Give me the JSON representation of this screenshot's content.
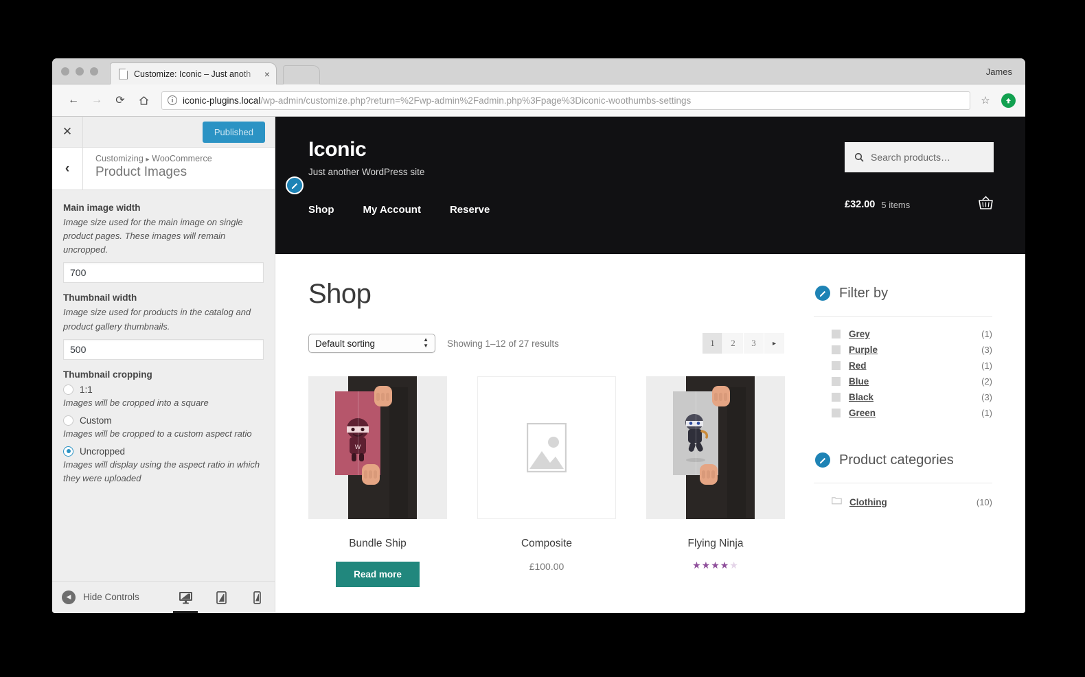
{
  "browser": {
    "tab_title": "Customize: Iconic – Just anoth",
    "tab_close": "×",
    "user": "James",
    "url_host": "iconic-plugins.local",
    "url_rest": "/wp-admin/customize.php?return=%2Fwp-admin%2Fadmin.php%3Fpage%3Diconic-woothumbs-settings",
    "info_glyph": "i",
    "back_glyph": "←",
    "forward_glyph": "→",
    "reload_glyph": "⟳",
    "home_glyph": "⌂",
    "bookmark_glyph": "☆"
  },
  "customizer": {
    "close_label": "✕",
    "publish_label": "Published",
    "back_glyph": "‹",
    "breadcrumb_root": "Customizing",
    "breadcrumb_sep": "▸",
    "breadcrumb_section": "WooCommerce",
    "panel_title": "Product Images",
    "controls": [
      {
        "label": "Main image width",
        "description": "Image size used for the main image on single product pages. These images will remain uncropped.",
        "value": "700"
      },
      {
        "label": "Thumbnail width",
        "description": "Image size used for products in the catalog and product gallery thumbnails.",
        "value": "500"
      }
    ],
    "cropping": {
      "label": "Thumbnail cropping",
      "options": [
        {
          "label": "1:1",
          "description": "Images will be cropped into a square",
          "selected": false
        },
        {
          "label": "Custom",
          "description": "Images will be cropped to a custom aspect ratio",
          "selected": false
        },
        {
          "label": "Uncropped",
          "description": "Images will display using the aspect ratio in which they were uploaded",
          "selected": true
        }
      ]
    },
    "footer": {
      "hide_controls_label": "Hide Controls",
      "devices": [
        "desktop-icon",
        "tablet-icon",
        "mobile-icon"
      ],
      "active_device": "desktop-icon"
    }
  },
  "site": {
    "title": "Iconic",
    "tagline": "Just another WordPress site",
    "nav": [
      {
        "label": "Shop"
      },
      {
        "label": "My Account"
      },
      {
        "label": "Reserve"
      }
    ],
    "search_placeholder": "Search products…",
    "cart": {
      "total": "£32.00",
      "items": "5 items",
      "icon": "basket-icon"
    }
  },
  "shop": {
    "heading": "Shop",
    "sorting_value": "Default sorting",
    "result_count": "Showing 1–12 of 27 results",
    "pagination": {
      "pages": [
        "1",
        "2",
        "3"
      ],
      "current": "1",
      "next_glyph": "▸"
    },
    "products": [
      {
        "name": "Bundle Ship",
        "price": "",
        "button": "Read more",
        "rating": null,
        "image": "poster-red-ninja"
      },
      {
        "name": "Composite",
        "price": "£100.00",
        "button": "",
        "rating": null,
        "image": "placeholder-image-icon"
      },
      {
        "name": "Flying Ninja",
        "price": "",
        "button": "",
        "rating": 4,
        "image": "poster-grey-ninja"
      }
    ]
  },
  "sidebar": {
    "filter_widget": {
      "title": "Filter by",
      "items": [
        {
          "label": "Grey",
          "count": "(1)"
        },
        {
          "label": "Purple",
          "count": "(3)"
        },
        {
          "label": "Red",
          "count": "(1)"
        },
        {
          "label": "Blue",
          "count": "(2)"
        },
        {
          "label": "Black",
          "count": "(3)"
        },
        {
          "label": "Green",
          "count": "(1)"
        }
      ]
    },
    "category_widget": {
      "title": "Product categories",
      "items": [
        {
          "label": "Clothing",
          "count": "(10)"
        }
      ]
    }
  },
  "colors": {
    "accent_blue": "#2b93c4",
    "header_black": "#111113",
    "button_teal": "#21877d",
    "star_purple": "#8f4f9b"
  }
}
